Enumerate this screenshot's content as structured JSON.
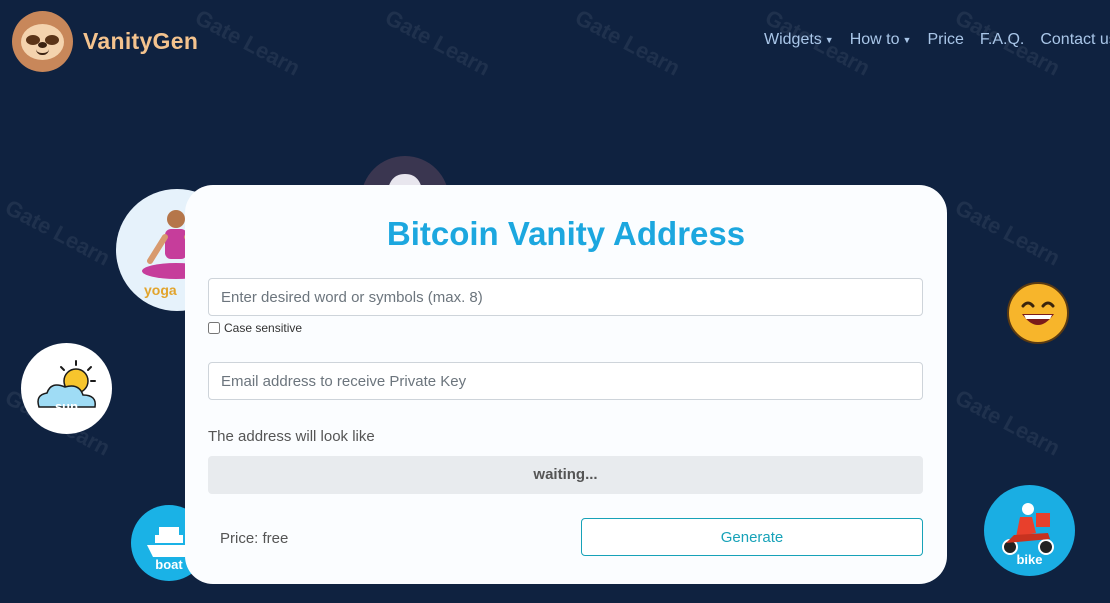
{
  "header": {
    "brand": "VanityGen",
    "nav": [
      {
        "label": "Widgets",
        "caret": true
      },
      {
        "label": "How to",
        "caret": true
      },
      {
        "label": "Price",
        "caret": false
      },
      {
        "label": "F.A.Q.",
        "caret": false
      },
      {
        "label": "Contact us",
        "caret": false
      }
    ]
  },
  "watermark": "Gate Learn",
  "icons": {
    "yoga": "yoga",
    "sun": "sun",
    "boat": "boat",
    "bike": "bike"
  },
  "card": {
    "title": "Bitcoin Vanity Address",
    "word_placeholder": "Enter desired word or symbols (max. 8)",
    "case_sensitive_label": "Case sensitive",
    "email_placeholder": "Email address to receive Private Key",
    "look_label": "The address will look like",
    "preview": "waiting...",
    "price": "Price: free",
    "generate_label": "Generate"
  },
  "colors": {
    "background": "#0f2240",
    "title": "#1ca7df",
    "accent": "#17a2b8"
  }
}
